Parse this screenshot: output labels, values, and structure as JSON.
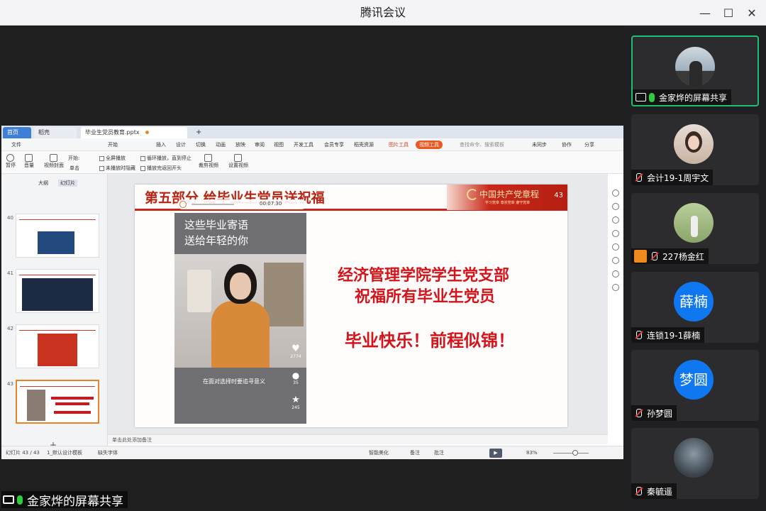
{
  "window": {
    "title": "腾讯会议",
    "minimize": "—",
    "maximize": "☐",
    "close": "✕"
  },
  "wps": {
    "tabs": {
      "home": "首页",
      "docs": "稻壳",
      "file": "毕业生党员教育.pptx",
      "add": "+"
    },
    "menu": [
      "文件",
      "开始",
      "插入",
      "设计",
      "切换",
      "动画",
      "放映",
      "审阅",
      "视图",
      "开发工具",
      "会员专享",
      "稻壳资源",
      "图片工具",
      "视频工具",
      "查找命令、搜索模板",
      "未同步",
      "协作",
      "分享"
    ],
    "menu_active": "视频工具",
    "ribbon": {
      "pause": "暂停",
      "volume": "音量",
      "cover": "视频封面",
      "start_label": "开始:",
      "start_value": "单击",
      "fullscreen": "全屏播放",
      "hide_when_not_playing": "未播放时隐藏",
      "loop": "循环播放，直到停止",
      "rewind": "播放完返回开头",
      "clip": "裁剪视频",
      "set_cover": "设置视频"
    },
    "pane_tabs": {
      "outline": "大纲",
      "slides": "幻灯片"
    },
    "thumbs": [
      {
        "num": "40",
        "title": "第五部分"
      },
      {
        "num": "41",
        "title": "第五部分"
      },
      {
        "num": "42",
        "title": "第五部分 · 重温入党誓词"
      },
      {
        "num": "43",
        "title": "第五部分 · 给毕业生党员送祝福"
      }
    ],
    "add_slide": "+",
    "notes": "单击此处添加备注",
    "status": {
      "slide_index": "幻灯片 43 / 43",
      "theme": "1_默认设计模板",
      "font_missing": "缺失字体",
      "beautify": "智能美化",
      "notes": "备注",
      "comments": "批注",
      "zoom": "83%"
    }
  },
  "slide": {
    "title": "第五部分  给毕业生党员送祝福",
    "banner_text": "中国共产党章程",
    "banner_slogan": "学习党章 尊崇党章 遵守党章",
    "page_number": "43",
    "video": {
      "time": "00:07.30",
      "caption_line1": "这些毕业寄语",
      "caption_line2": "送给年轻的你",
      "subtitle": "在面对选择时要追寻意义",
      "likes": "2774",
      "comments": "35",
      "stars": "245"
    },
    "message_line1": "经济管理学院学生党支部",
    "message_line2": "祝福所有毕业生党员",
    "message_line3": "毕业快乐！前程似锦！"
  },
  "sharer_tag": "金家烨的屏幕共享",
  "participants": [
    {
      "name": "金家烨的屏幕共享",
      "mic": "on",
      "kind": "share"
    },
    {
      "name": "会计19-1周宇文",
      "mic": "off"
    },
    {
      "name": "227杨金红",
      "mic": "off",
      "kind": "user"
    },
    {
      "name": "连锁19-1薛楠",
      "mic": "off",
      "avatar_text": "薛楠"
    },
    {
      "name": "孙梦圆",
      "mic": "off",
      "avatar_text": "梦圆"
    },
    {
      "name": "秦毓遥",
      "mic": "off"
    }
  ],
  "colors": {
    "accent_green": "#1dbf73",
    "avatar_blue": "#0f77f0",
    "party_red": "#c62818"
  }
}
